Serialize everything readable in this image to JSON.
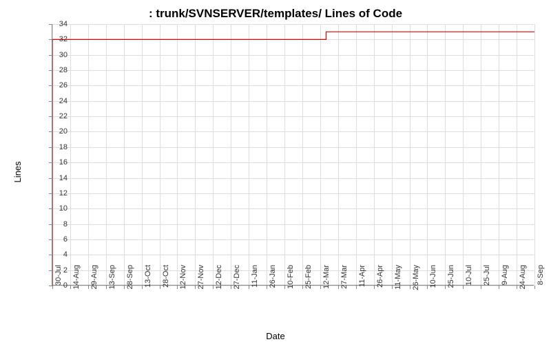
{
  "chart_data": {
    "type": "line",
    "title": ": trunk/SVNSERVER/templates/ Lines of Code",
    "xlabel": "Date",
    "ylabel": "Lines",
    "ylim": [
      0,
      34
    ],
    "y_ticks": [
      0,
      2,
      4,
      6,
      8,
      10,
      12,
      14,
      16,
      18,
      20,
      22,
      24,
      26,
      28,
      30,
      32,
      34
    ],
    "x_ticks": [
      "30-Jul",
      "14-Aug",
      "29-Aug",
      "13-Sep",
      "28-Sep",
      "13-Oct",
      "28-Oct",
      "12-Nov",
      "27-Nov",
      "12-Dec",
      "27-Dec",
      "11-Jan",
      "26-Jan",
      "10-Feb",
      "25-Feb",
      "12-Mar",
      "27-Mar",
      "11-Apr",
      "26-Apr",
      "11-May",
      "26-May",
      "10-Jun",
      "25-Jun",
      "10-Jul",
      "25-Jul",
      "9-Aug",
      "24-Aug",
      "8-Sep"
    ],
    "series": [
      {
        "name": "Lines of Code",
        "color": "#e00000",
        "points": [
          {
            "x": "30-Jul",
            "y": 0
          },
          {
            "x": "30-Jul",
            "y": 32
          },
          {
            "x": "17-Mar",
            "y": 32
          },
          {
            "x": "17-Mar",
            "y": 33
          },
          {
            "x": "8-Sep",
            "y": 33
          }
        ]
      }
    ]
  }
}
